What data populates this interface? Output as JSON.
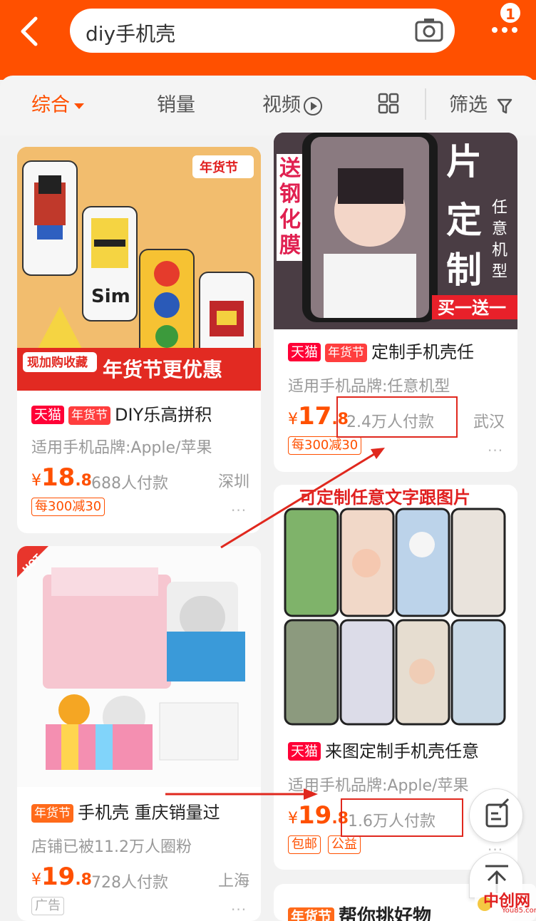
{
  "header": {
    "search_value": "diy手机壳",
    "message_count": "1",
    "accent": "#ff5000"
  },
  "filters": {
    "comprehensive": "综合",
    "sales": "销量",
    "video": "视频",
    "filter": "筛选"
  },
  "products": [
    {
      "image_text": [
        "现加购收藏",
        "年货节更优惠",
        "年货节",
        "Sim"
      ],
      "tags": [
        "天猫",
        "年货节"
      ],
      "title": "DIY乐高拼积",
      "sub": "适用手机品牌:Apple/苹果",
      "price_cur": "¥",
      "price_int": "18",
      "price_dec": ".8",
      "pay": "688人付款",
      "loc": "深圳",
      "promo": "每300减30",
      "more": "···"
    },
    {
      "image_text": [
        "送钢化膜",
        "照片定制",
        "任意机型",
        "买一送一"
      ],
      "tags": [
        "天猫",
        "年货节"
      ],
      "title": "定制手机壳任",
      "sub": "适用手机品牌:任意机型",
      "price_cur": "¥",
      "price_int": "17",
      "price_dec": ".8",
      "pay": "2.4万人付款",
      "loc": "武汉",
      "promo": "每300减30",
      "more": "···"
    },
    {
      "image_text": [
        "HOT"
      ],
      "tags": [
        "年货节"
      ],
      "title": "手机壳 重庆销量过",
      "sub": "店铺已被11.2万人圈粉",
      "price_cur": "¥",
      "price_int": "19",
      "price_dec": ".8",
      "pay": "728人付款",
      "loc": "上海",
      "promo": "广告",
      "more": "···"
    },
    {
      "image_text": [
        "可定制任意文字跟图片"
      ],
      "tags": [
        "天猫"
      ],
      "title": "来图定制手机壳任意",
      "sub": "适用手机品牌:Apple/苹果",
      "price_cur": "¥",
      "price_int": "19",
      "price_dec": ".8",
      "pay": "1.6万人付款",
      "promo": [
        "包邮",
        "公益"
      ],
      "more": "···"
    },
    {
      "tags": [
        "年货节"
      ],
      "title": "帮你挑好物"
    }
  ],
  "watermark": {
    "text": "中创网",
    "sub": "You85.com"
  }
}
